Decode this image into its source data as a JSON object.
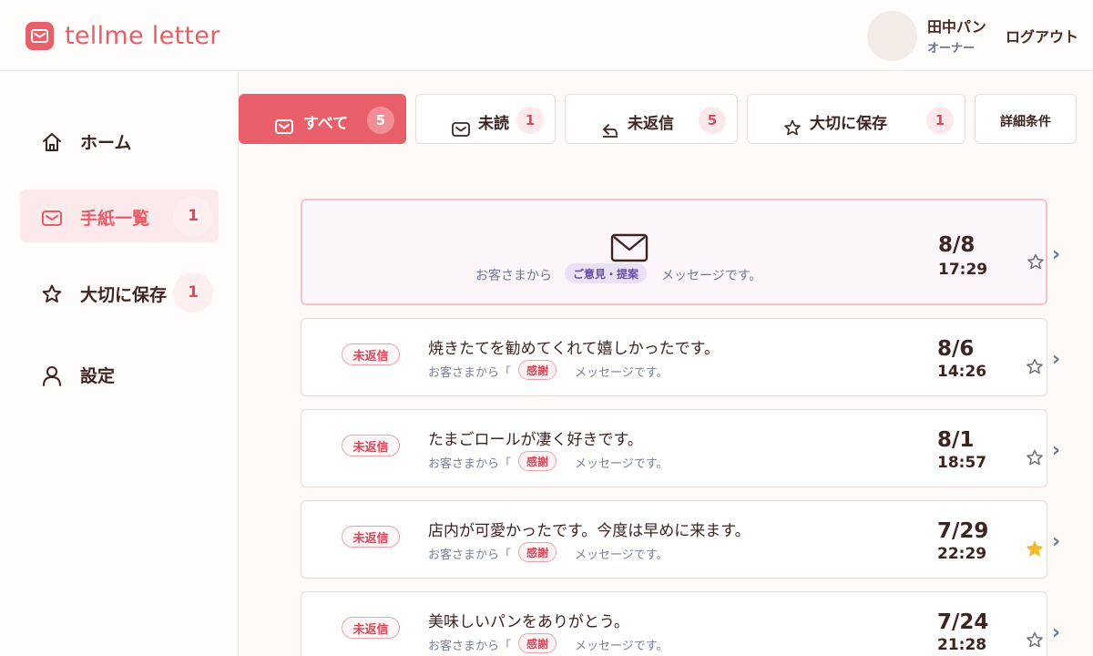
{
  "header": {
    "logo_text": "tellme letter",
    "user_name": "田中パン",
    "user_role": "オーナー",
    "logout_label": "ログアウト"
  },
  "sidebar": {
    "items": [
      {
        "label": "ホーム",
        "icon": "home-icon"
      },
      {
        "label": "手紙一覧",
        "icon": "mail-icon",
        "badge": "1",
        "active": true
      },
      {
        "label": "大切に保存",
        "icon": "star-icon",
        "badge": "1"
      },
      {
        "label": "設定",
        "icon": "user-icon"
      }
    ]
  },
  "filters": {
    "tabs": [
      {
        "label": "すべて",
        "count": "5",
        "icon": "mail-icon",
        "active": true
      },
      {
        "label": "未読",
        "count": "1",
        "icon": "mail-icon"
      },
      {
        "label": "未返信",
        "count": "5",
        "icon": "reply-icon"
      },
      {
        "label": "大切に保存",
        "count": "1",
        "icon": "star-icon"
      }
    ],
    "detail_label": "詳細条件"
  },
  "letters": [
    {
      "status": "",
      "title": "",
      "sub_prefix": "お客さまから",
      "category": "ご意見・提案",
      "sub_suffix": "メッセージです。",
      "date": "8/8",
      "time": "17:29",
      "starred": false,
      "unread": true
    },
    {
      "status": "未返信",
      "title": "焼きたてを勧めてくれて嬉しかったです。",
      "sub_prefix": "お客さまから「",
      "category": "感謝",
      "sub_suffix": "メッセージです。",
      "date": "8/6",
      "time": "14:26",
      "starred": false
    },
    {
      "status": "未返信",
      "title": "たまごロールが凄く好きです。",
      "sub_prefix": "お客さまから「",
      "category": "感謝",
      "sub_suffix": "メッセージです。",
      "date": "8/1",
      "time": "18:57",
      "starred": false
    },
    {
      "status": "未返信",
      "title": "店内が可愛かったです。今度は早めに来ます。",
      "sub_prefix": "お客さまから「",
      "category": "感謝",
      "sub_suffix": "メッセージです。",
      "date": "7/29",
      "time": "22:29",
      "starred": true
    },
    {
      "status": "未返信",
      "title": "美味しいパンをありがとう。",
      "sub_prefix": "お客さまから「",
      "category": "感謝",
      "sub_suffix": "メッセージです。",
      "date": "7/24",
      "time": "21:28",
      "starred": false
    }
  ],
  "colors": {
    "brand": "#e95f69",
    "badge_bg": "#fde8eb",
    "star_filled": "#f5b82e",
    "category_purple": "#ebe1f7"
  }
}
